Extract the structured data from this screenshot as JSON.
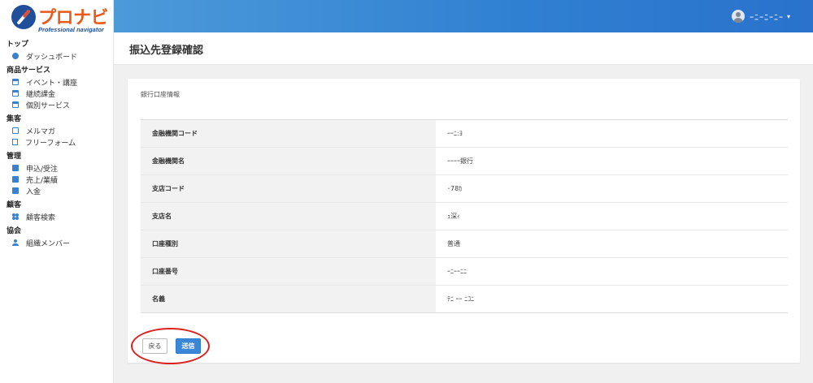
{
  "app": {
    "logo_title": "プロナビ",
    "logo_subtitle": "Professional navigator"
  },
  "sidebar": {
    "groups": [
      {
        "heading": "トップ",
        "items": [
          {
            "label": "ダッシュボード",
            "icon": "dashboard-icon"
          }
        ]
      },
      {
        "heading": "商品サービス",
        "items": [
          {
            "label": "イベント・講座",
            "icon": "calendar-icon"
          },
          {
            "label": "継続課金",
            "icon": "calendar-icon"
          },
          {
            "label": "個別サービス",
            "icon": "calendar-icon"
          }
        ]
      },
      {
        "heading": "集客",
        "items": [
          {
            "label": "メルマガ",
            "icon": "mail-icon"
          },
          {
            "label": "フリーフォーム",
            "icon": "form-icon"
          }
        ]
      },
      {
        "heading": "管理",
        "items": [
          {
            "label": "申込/受注",
            "icon": "folder-icon"
          },
          {
            "label": "売上/業績",
            "icon": "folder-icon"
          },
          {
            "label": "入金",
            "icon": "folder-icon"
          }
        ]
      },
      {
        "heading": "顧客",
        "items": [
          {
            "label": "顧客検索",
            "icon": "users-icon"
          }
        ]
      },
      {
        "heading": "協会",
        "items": [
          {
            "label": "組織メンバー",
            "icon": "user-icon"
          }
        ]
      }
    ]
  },
  "header": {
    "user_name": "ｰﾆｰﾆｰﾆｰ",
    "caret": "▾"
  },
  "page": {
    "title": "振込先登録確認"
  },
  "card": {
    "section_label": "銀行口座情報",
    "rows": [
      {
        "label": "金融機関コード",
        "value": "ｰｰﾆ:ﾖ"
      },
      {
        "label": "金融機関名",
        "value": "ｰｰｰｰ銀行"
      },
      {
        "label": "支店コード",
        "value": "･78ｶ"
      },
      {
        "label": "支店名",
        "value": "ｭ深ｨ"
      },
      {
        "label": "口座種別",
        "value": "普通"
      },
      {
        "label": "口座番号",
        "value": "ｰﾆｰｰﾆﾆ"
      },
      {
        "label": "名義",
        "value": "ﾃﾆ ｰｰ ﾆｺﾆ"
      }
    ],
    "back_button": "戻る",
    "send_button": "送信"
  },
  "colors": {
    "header_gradient_start": "#4d9ad9",
    "header_gradient_end": "#2a72cc",
    "accent": "#3a86d8",
    "logo_orange": "#e85a1c",
    "annotation_red": "#d9211f"
  }
}
